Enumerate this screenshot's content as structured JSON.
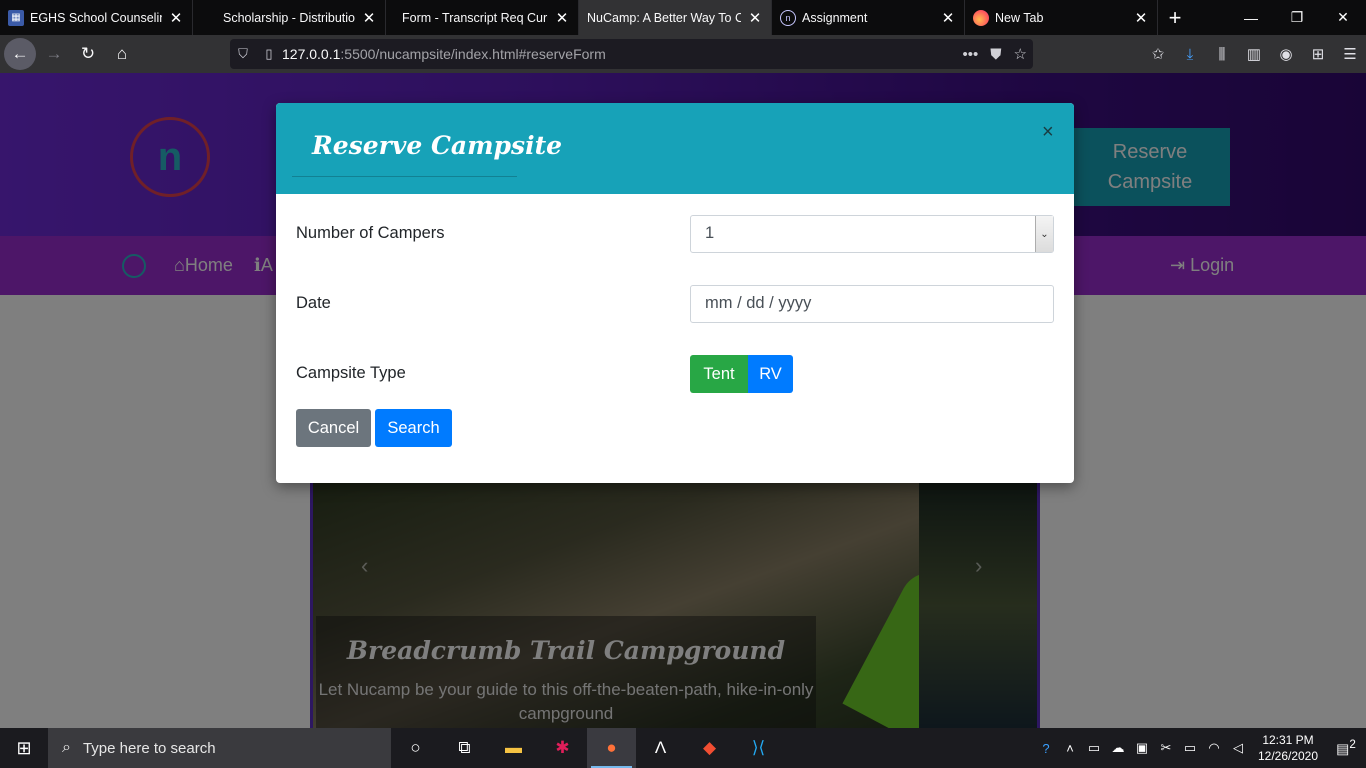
{
  "browser": {
    "tabs": [
      {
        "title": "EGHS School Counseling",
        "icon": "calendar-icon",
        "active": false
      },
      {
        "title": "Scholarship - Distribution",
        "icon": "none",
        "active": false
      },
      {
        "title": "Form - Transcript Req Current",
        "icon": "none",
        "active": false
      },
      {
        "title": "NuCamp: A Better Way To Camp",
        "icon": "none",
        "active": true
      },
      {
        "title": "Assignment",
        "icon": "nucamp-icon",
        "active": false
      },
      {
        "title": "New Tab",
        "icon": "firefox-icon",
        "active": false
      }
    ],
    "url_host": "127.0.0.1",
    "url_path": ":5500/nucampsite/index.html#reserveForm",
    "window_controls": [
      "—",
      "❐",
      "✕"
    ]
  },
  "site": {
    "reserve_button": "Reserve Campsite",
    "nav": {
      "home": "Home",
      "about": "A",
      "login": "Login"
    },
    "carousel": {
      "title": "Breadcrumb Trail Campground",
      "text": "Let Nucamp be your guide to this off-the-beaten-path, hike-in-only campground"
    }
  },
  "modal": {
    "title": "Reserve Campsite",
    "close": "×",
    "fields": {
      "campers_label": "Number of Campers",
      "campers_value": "1",
      "date_label": "Date",
      "date_placeholder": "mm / dd / yyyy",
      "type_label": "Campsite Type",
      "type_tent": "Tent",
      "type_rv": "RV"
    },
    "buttons": {
      "cancel": "Cancel",
      "search": "Search"
    }
  },
  "taskbar": {
    "search_placeholder": "Type here to search",
    "time": "12:31 PM",
    "date": "12/26/2020",
    "notification_count": "2"
  }
}
